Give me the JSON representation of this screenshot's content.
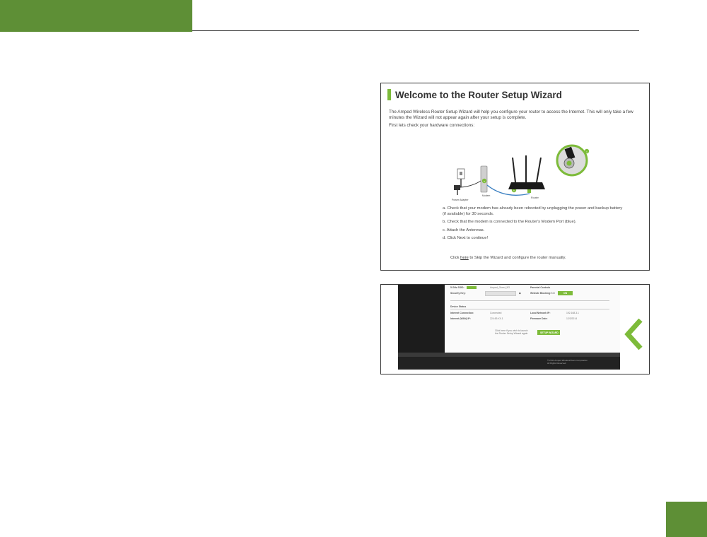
{
  "wizard": {
    "title": "Welcome to the Router Setup Wizard",
    "intro": "The Amped Wireless Router Setup Wizard will help you configure your router to access the Internet. This will only take a few minutes the Wizard will not appear again after your setup is complete.",
    "check": "First lets check your hardware connections:",
    "labels": {
      "power_adapter": "Power Adapter",
      "modem": "Modem",
      "router": "Router"
    },
    "steps": [
      "a.  Check that your modem has already been rebooted by unplugging the power and backup battery (if available) for 30 seconds.",
      "b.  Check that the modem is connected to the Router's Modem Port (blue).",
      "c.  Attach the Antennas.",
      "d.  Click Next to continue!"
    ],
    "skip_pre": "Click ",
    "skip_link": "here",
    "skip_post": " to Skip the Wizard and configure the router manually."
  },
  "status": {
    "ssid_label": "5 GHz SSID:",
    "ssid_value": "Amped_Guest_5G",
    "security_label": "Security Key:",
    "parental_title": "Parental Controls",
    "website_label": "Website Blocking:",
    "website_value": "Edit",
    "toggle_value": "ON",
    "device_status": "Device Status",
    "internet_connection_label": "Internet Connection:",
    "internet_connection_value": "Connected",
    "local_network_label": "Local Network IP:",
    "local_network_value": "192.168.3.1",
    "internet_ip_label": "Internet (WAN) IP:",
    "internet_ip_value": "224.69.XX.1",
    "firmware_label": "Firmware Date:",
    "firmware_value": "12/3/2014",
    "wizard_hint_line1": "Click here if you wish to launch",
    "wizard_hint_line2": "the Router Setup Wizard again",
    "wizard_button": "SETUP WIZARD",
    "footer_line1": "© 2014 Amped Wireless/Team Corporation",
    "footer_line2": "All Rights Reserved.",
    "accent_color": "#7dbb3a"
  },
  "page": {
    "brand_color": "#5e8f36"
  }
}
